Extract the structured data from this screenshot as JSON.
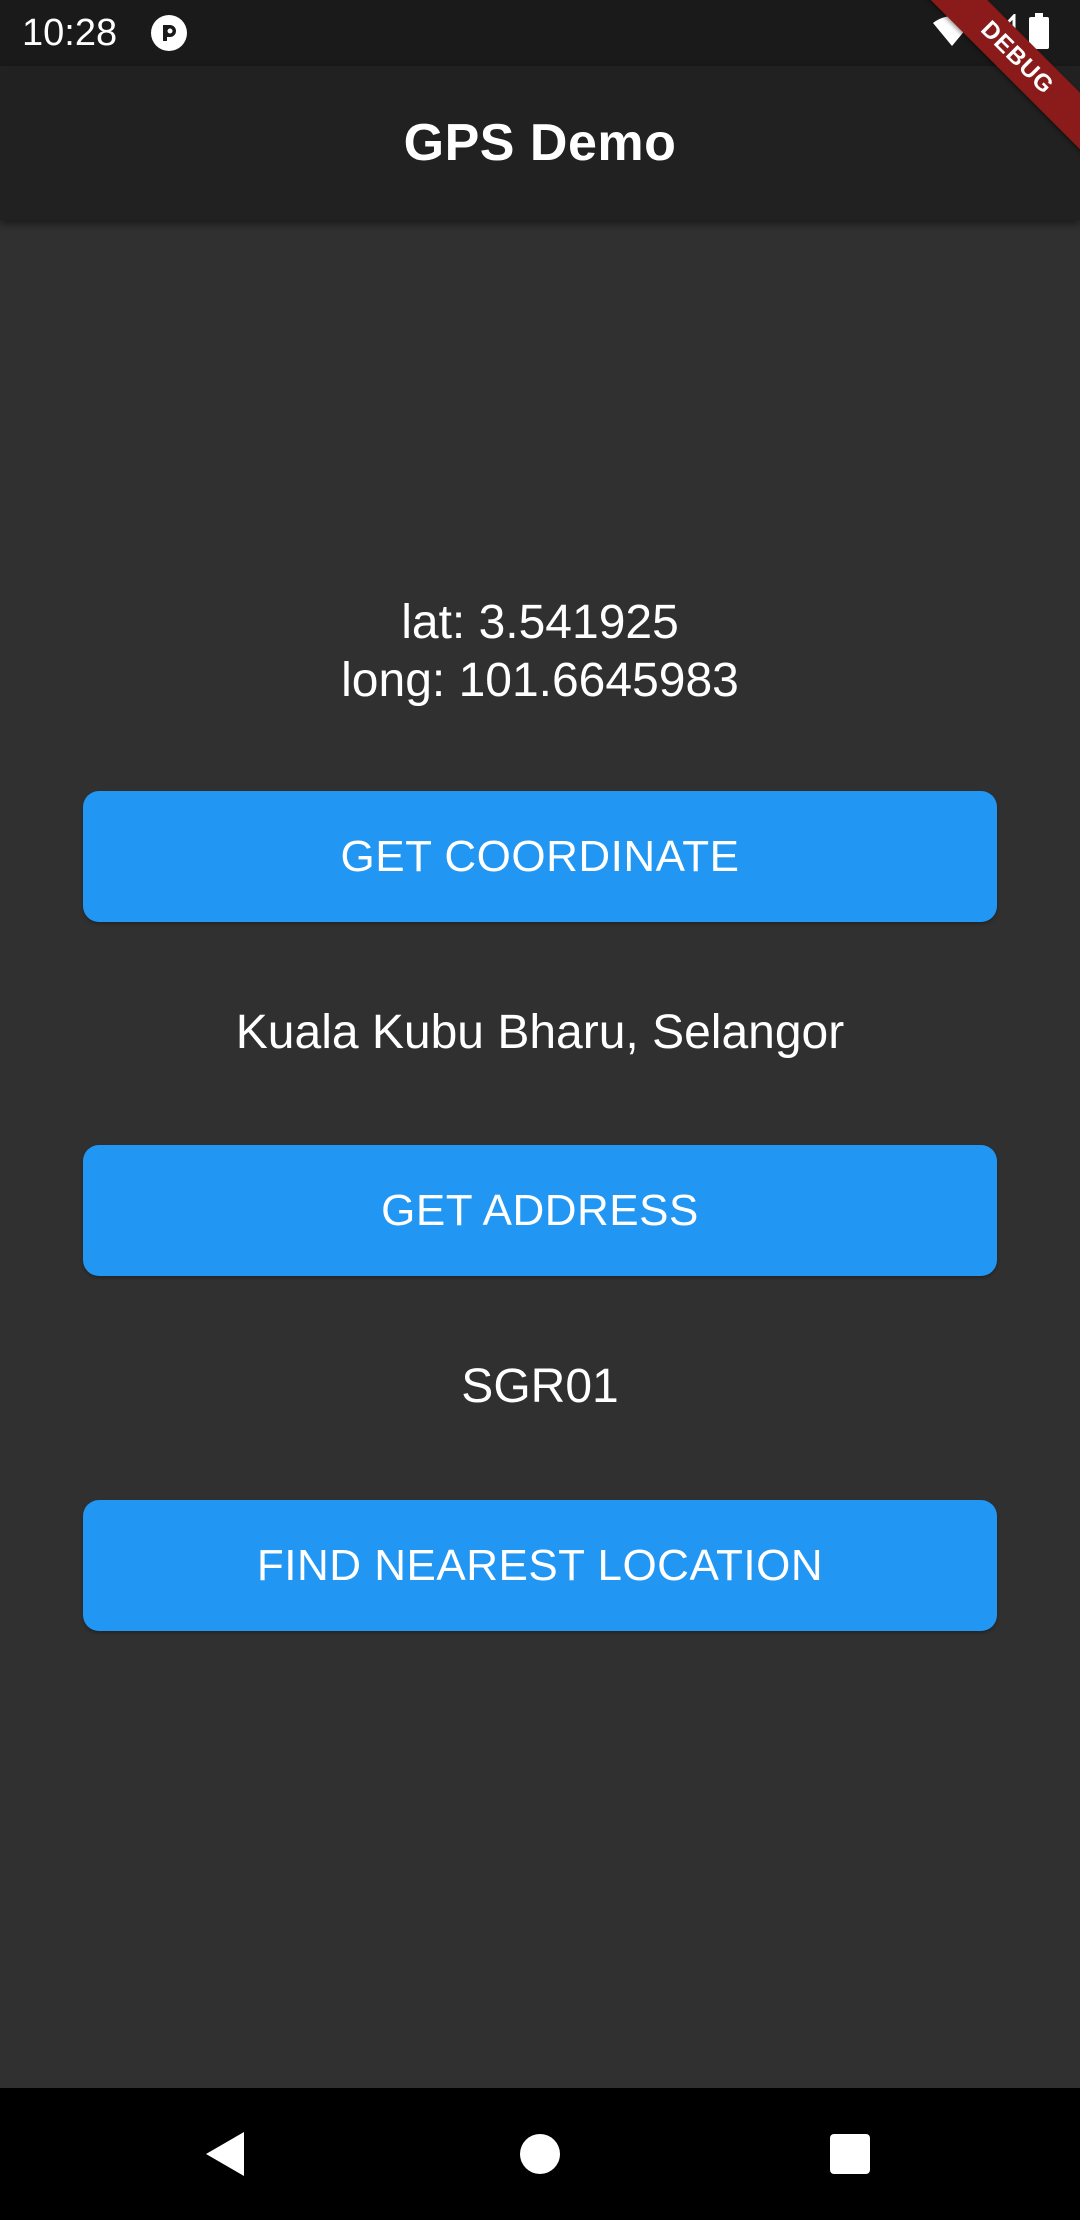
{
  "status_bar": {
    "time": "10:28"
  },
  "debug_banner": {
    "label": "DEBUG"
  },
  "app_bar": {
    "title": "GPS Demo"
  },
  "location": {
    "lat_line": "lat: 3.541925",
    "long_line": "long: 101.6645983",
    "get_coordinate_label": "GET COORDINATE",
    "address": "Kuala Kubu Bharu, Selangor",
    "get_address_label": "GET ADDRESS",
    "nearest_code": "SGR01",
    "find_nearest_label": "FIND NEAREST LOCATION"
  },
  "icons": {
    "status_app": "app-notification-icon",
    "wifi": "wifi-icon",
    "signal": "cell-signal-icon",
    "battery": "battery-icon",
    "back": "back-icon",
    "home": "home-icon",
    "recents": "recents-icon"
  },
  "colors": {
    "background": "#303030",
    "app_bar": "#212121",
    "button": "#2196f3",
    "debug_banner": "#8b1a1a",
    "text": "#ffffff"
  }
}
